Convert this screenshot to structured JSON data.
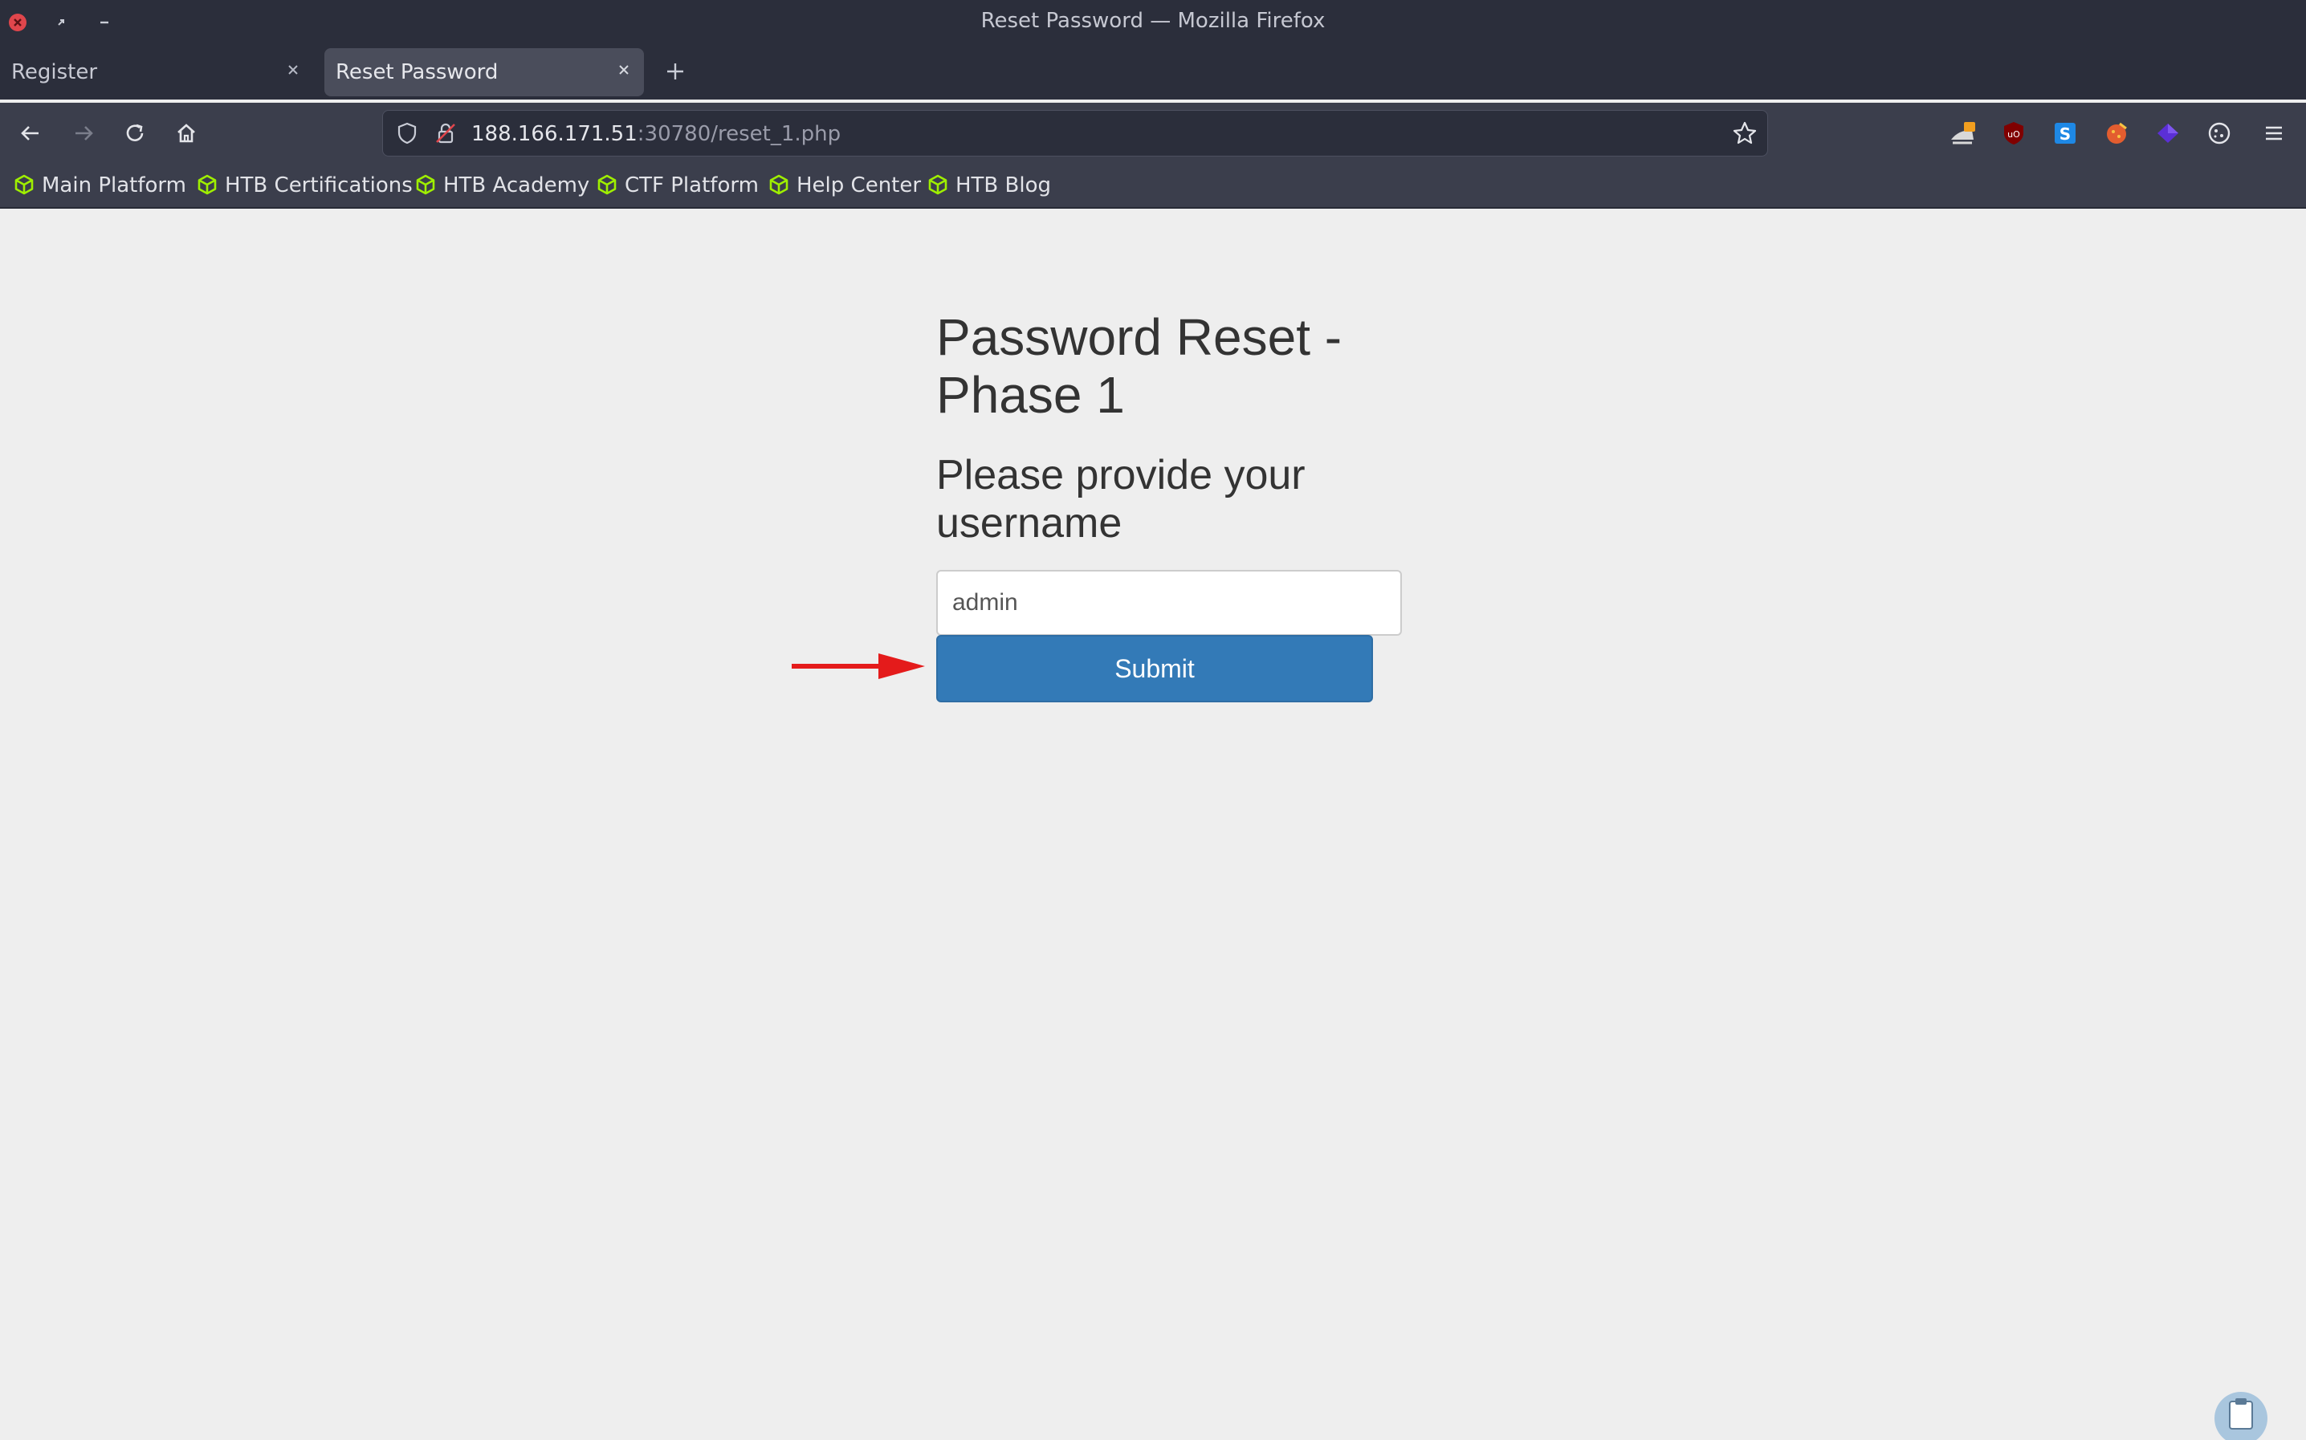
{
  "window": {
    "title": "Reset Password — Mozilla Firefox"
  },
  "tabs": [
    {
      "label": "Register",
      "active": false
    },
    {
      "label": "Reset Password",
      "active": true
    }
  ],
  "address_bar": {
    "host": "188.166.171.51",
    "rest": ":30780/reset_1.php"
  },
  "bookmarks": [
    {
      "label": "Main Platform"
    },
    {
      "label": "HTB Certifications"
    },
    {
      "label": "HTB Academy"
    },
    {
      "label": "CTF Platform"
    },
    {
      "label": "Help Center"
    },
    {
      "label": "HTB Blog"
    }
  ],
  "page": {
    "heading": "Password Reset - Phase 1",
    "subheading": "Please provide your username",
    "username_value": "admin",
    "submit_label": "Submit"
  },
  "colors": {
    "chrome_dark": "#2b2e3b",
    "chrome_toolbar": "#3b3e4c",
    "page_bg": "#eeeeee",
    "submit_bg": "#337ab7",
    "bookmark_icon": "#9fef00",
    "annotation_arrow": "#e41b1b"
  }
}
